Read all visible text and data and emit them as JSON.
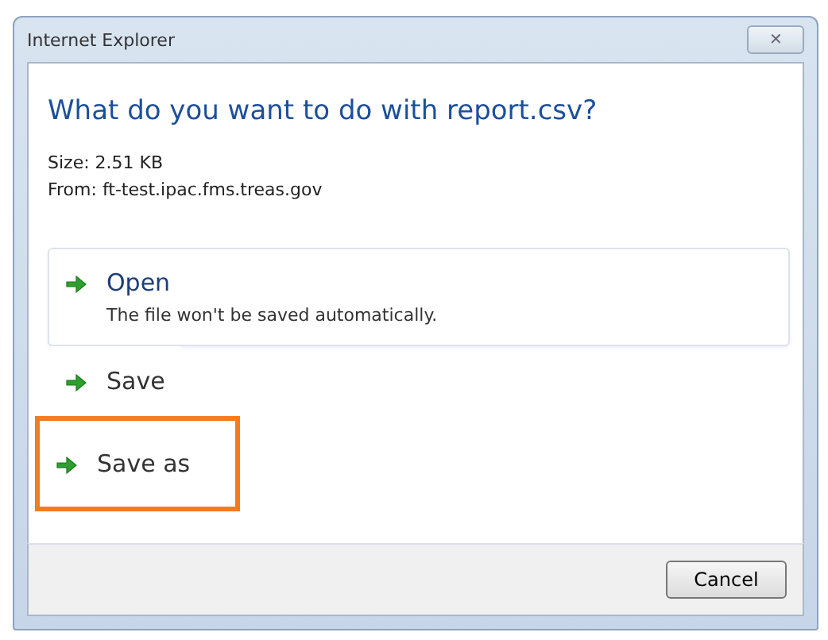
{
  "window": {
    "title": "Internet Explorer",
    "close_glyph": "✕"
  },
  "heading": "What do you want to do with report.csv?",
  "details": [
    "Size: 2.51 KB",
    "From: ft-test.ipac.fms.treas.gov"
  ],
  "options": [
    {
      "label": "Open",
      "description": "The file won't be saved automatically.",
      "selected": true,
      "highlighted": false
    },
    {
      "label": "Save",
      "selected": false,
      "highlighted": false
    },
    {
      "label": "Save as",
      "selected": false,
      "highlighted": true
    }
  ],
  "buttons": [
    "Cancel"
  ]
}
